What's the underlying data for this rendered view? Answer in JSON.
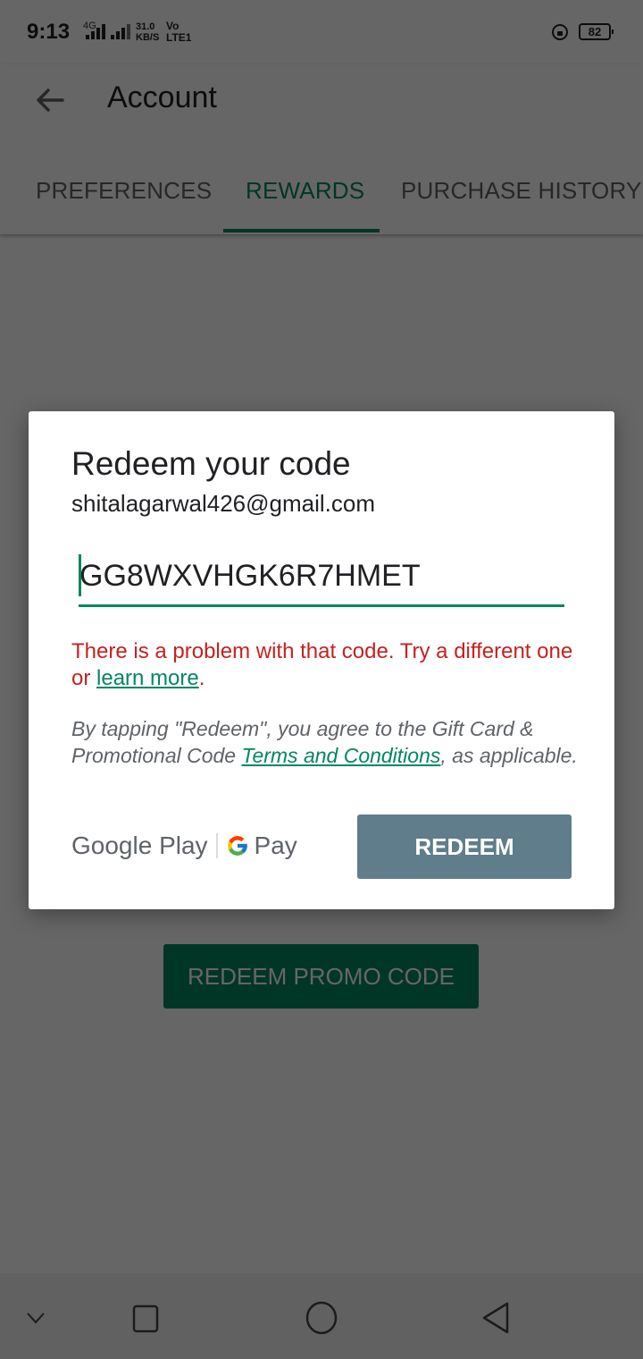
{
  "status_bar": {
    "time": "9:13",
    "network_type": "4G",
    "data_speed_value": "31.0",
    "data_speed_unit": "KB/S",
    "volte_top": "Vo",
    "volte_bottom": "LTE1",
    "battery_level": "82"
  },
  "app_bar": {
    "title": "Account",
    "back_icon": "arrow-left-icon"
  },
  "tabs": [
    {
      "label": "PREFERENCES",
      "active": false
    },
    {
      "label": "REWARDS",
      "active": true
    },
    {
      "label": "PURCHASE HISTORY",
      "active": false
    }
  ],
  "background": {
    "promo_button_label": "REDEEM PROMO CODE"
  },
  "dialog": {
    "title": "Redeem your code",
    "email": "shitalagarwal426@gmail.com",
    "code_value": "GG8WXVHGK6R7HMET",
    "error_prefix": "There is a problem with that code. Try a different one or ",
    "error_link": "learn more",
    "error_suffix": ".",
    "terms_prefix": "By tapping \"Redeem\", you agree to the Gift Card & Promotional Code ",
    "terms_link": "Terms and Conditions",
    "terms_suffix": ", as applicable.",
    "brand_left": "Google Play",
    "brand_right": "Pay",
    "redeem_label": "REDEEM"
  },
  "nav_bar": {
    "icons": [
      "chevron-down-icon",
      "recents-square-icon",
      "home-circle-icon",
      "back-triangle-icon"
    ]
  },
  "colors": {
    "accent_green": "#01875f",
    "error_red": "#c5221f",
    "redeem_button": "#607d8b"
  }
}
